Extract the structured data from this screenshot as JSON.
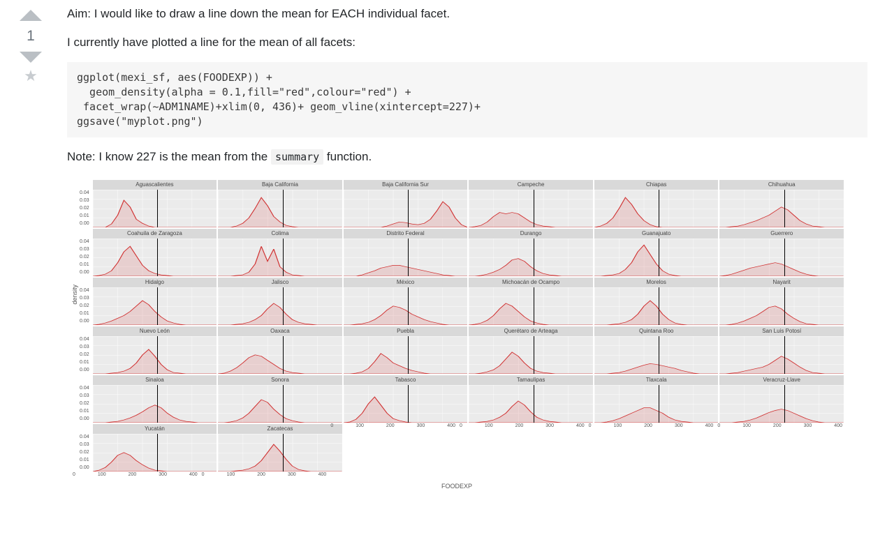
{
  "vote": {
    "count": "1"
  },
  "post": {
    "aim": "Aim: I would like to draw a line down the mean for EACH individual facet.",
    "intro": "I currently have plotted a line for the mean of all facets:",
    "code": "ggplot(mexi_sf, aes(FOODEXP)) +\n  geom_density(alpha = 0.1,fill=\"red\",colour=\"red\") +\n facet_wrap(~ADM1NAME)+xlim(0, 436)+ geom_vline(xintercept=227)+\nggsave(\"myplot.png\")",
    "note_prefix": "Note: I know 227 is the mean from the ",
    "note_code": "summary",
    "note_suffix": " function."
  },
  "chart_data": {
    "type": "facet-density",
    "xlabel": "FOODEXP",
    "ylabel": "density",
    "xlim": [
      0,
      436
    ],
    "xticks": [
      "0",
      "100",
      "200",
      "300",
      "400"
    ],
    "yticks": [
      "0.04",
      "0.03",
      "0.02",
      "0.01",
      "0.00"
    ],
    "vline_x": 227,
    "fill": "#ff9d9d",
    "stroke": "#d02f2f",
    "alpha": 0.15,
    "cols": 6,
    "facets": [
      {
        "name": "Aguascalientes",
        "curve": [
          0,
          0,
          0,
          5,
          18,
          40,
          30,
          12,
          6,
          2,
          0,
          0,
          0,
          0,
          0,
          0,
          0,
          0,
          0,
          0,
          0
        ]
      },
      {
        "name": "Baja California",
        "curve": [
          0,
          0,
          0,
          2,
          6,
          14,
          28,
          44,
          32,
          16,
          8,
          3,
          1,
          0,
          0,
          0,
          0,
          0,
          0,
          0,
          0
        ]
      },
      {
        "name": "Baja California Sur",
        "curve": [
          0,
          0,
          0,
          0,
          0,
          0,
          0,
          2,
          5,
          8,
          7,
          5,
          4,
          6,
          12,
          24,
          38,
          30,
          14,
          4,
          0
        ]
      },
      {
        "name": "Campeche",
        "curve": [
          0,
          1,
          3,
          8,
          16,
          22,
          20,
          22,
          20,
          14,
          8,
          4,
          2,
          1,
          0,
          0,
          0,
          0,
          0,
          0,
          0
        ]
      },
      {
        "name": "Chiapas",
        "curve": [
          0,
          2,
          6,
          14,
          28,
          44,
          34,
          20,
          10,
          4,
          1,
          0,
          0,
          0,
          0,
          0,
          0,
          0,
          0,
          0,
          0
        ]
      },
      {
        "name": "Chihuahua",
        "curve": [
          0,
          0,
          1,
          2,
          4,
          7,
          10,
          14,
          18,
          24,
          30,
          26,
          18,
          10,
          5,
          2,
          1,
          0,
          0,
          0,
          0
        ]
      },
      {
        "name": "Coahuila de Zaragoza",
        "curve": [
          0,
          1,
          3,
          8,
          20,
          36,
          44,
          30,
          16,
          8,
          4,
          2,
          1,
          0,
          0,
          0,
          0,
          0,
          0,
          0,
          0
        ]
      },
      {
        "name": "Colima",
        "curve": [
          0,
          0,
          0,
          1,
          2,
          6,
          18,
          44,
          22,
          40,
          14,
          6,
          2,
          1,
          0,
          0,
          0,
          0,
          0,
          0,
          0
        ]
      },
      {
        "name": "Distrito Federal",
        "curve": [
          0,
          0,
          0,
          2,
          5,
          8,
          12,
          14,
          16,
          16,
          14,
          12,
          10,
          8,
          6,
          4,
          2,
          1,
          0,
          0,
          0
        ]
      },
      {
        "name": "Durango",
        "curve": [
          0,
          0,
          1,
          3,
          6,
          10,
          16,
          24,
          26,
          22,
          14,
          8,
          4,
          2,
          1,
          0,
          0,
          0,
          0,
          0,
          0
        ]
      },
      {
        "name": "Guanajuato",
        "curve": [
          0,
          0,
          1,
          2,
          4,
          10,
          20,
          36,
          46,
          32,
          18,
          8,
          3,
          1,
          0,
          0,
          0,
          0,
          0,
          0,
          0
        ]
      },
      {
        "name": "Guerrero",
        "curve": [
          0,
          1,
          3,
          6,
          9,
          12,
          14,
          16,
          18,
          20,
          18,
          14,
          10,
          6,
          3,
          1,
          0,
          0,
          0,
          0,
          0
        ]
      },
      {
        "name": "Hidalgo",
        "curve": [
          0,
          1,
          3,
          6,
          10,
          14,
          20,
          28,
          36,
          30,
          20,
          12,
          6,
          3,
          1,
          0,
          0,
          0,
          0,
          0,
          0
        ]
      },
      {
        "name": "Jalisco",
        "curve": [
          0,
          0,
          0,
          1,
          2,
          4,
          8,
          14,
          24,
          32,
          26,
          16,
          8,
          4,
          2,
          1,
          0,
          0,
          0,
          0,
          0
        ]
      },
      {
        "name": "México",
        "curve": [
          0,
          0,
          1,
          2,
          4,
          8,
          14,
          22,
          28,
          26,
          22,
          16,
          12,
          8,
          5,
          3,
          1,
          0,
          0,
          0,
          0
        ]
      },
      {
        "name": "Michoacán de Ocampo",
        "curve": [
          0,
          1,
          3,
          7,
          14,
          24,
          32,
          28,
          20,
          12,
          6,
          3,
          1,
          0,
          0,
          0,
          0,
          0,
          0,
          0,
          0
        ]
      },
      {
        "name": "Morelos",
        "curve": [
          0,
          0,
          0,
          1,
          2,
          4,
          8,
          16,
          28,
          36,
          28,
          16,
          8,
          3,
          1,
          0,
          0,
          0,
          0,
          0,
          0
        ]
      },
      {
        "name": "Nayarit",
        "curve": [
          0,
          0,
          1,
          3,
          6,
          10,
          14,
          20,
          26,
          28,
          24,
          16,
          10,
          5,
          2,
          1,
          0,
          0,
          0,
          0,
          0
        ]
      },
      {
        "name": "Nuevo León",
        "curve": [
          0,
          0,
          0,
          1,
          2,
          4,
          8,
          16,
          28,
          36,
          26,
          14,
          6,
          2,
          1,
          0,
          0,
          0,
          0,
          0,
          0
        ]
      },
      {
        "name": "Oaxaca",
        "curve": [
          0,
          1,
          4,
          9,
          16,
          24,
          28,
          26,
          20,
          14,
          8,
          4,
          2,
          1,
          0,
          0,
          0,
          0,
          0,
          0,
          0
        ]
      },
      {
        "name": "Puebla",
        "curve": [
          0,
          0,
          1,
          3,
          8,
          18,
          30,
          24,
          16,
          12,
          8,
          5,
          3,
          1,
          0,
          0,
          0,
          0,
          0,
          0,
          0
        ]
      },
      {
        "name": "Querétaro de Arteaga",
        "curve": [
          0,
          0,
          1,
          3,
          6,
          12,
          22,
          32,
          26,
          16,
          8,
          4,
          2,
          1,
          0,
          0,
          0,
          0,
          0,
          0,
          0
        ]
      },
      {
        "name": "Quintana Roo",
        "curve": [
          0,
          0,
          0,
          1,
          2,
          4,
          7,
          10,
          13,
          15,
          14,
          12,
          10,
          8,
          5,
          3,
          1,
          0,
          0,
          0,
          0
        ]
      },
      {
        "name": "San Luis Potosí",
        "curve": [
          0,
          0,
          1,
          2,
          4,
          6,
          8,
          10,
          14,
          20,
          26,
          22,
          16,
          10,
          5,
          2,
          1,
          0,
          0,
          0,
          0
        ]
      },
      {
        "name": "Sinaloa",
        "curve": [
          0,
          0,
          0,
          1,
          2,
          4,
          7,
          11,
          16,
          22,
          26,
          22,
          14,
          8,
          4,
          2,
          1,
          0,
          0,
          0,
          0
        ]
      },
      {
        "name": "Sonora",
        "curve": [
          0,
          0,
          1,
          3,
          7,
          14,
          24,
          34,
          30,
          20,
          12,
          6,
          3,
          1,
          0,
          0,
          0,
          0,
          0,
          0,
          0
        ]
      },
      {
        "name": "Tabasco",
        "curve": [
          0,
          1,
          5,
          14,
          28,
          38,
          26,
          14,
          6,
          3,
          1,
          0,
          0,
          0,
          0,
          0,
          0,
          0,
          0,
          0,
          0
        ]
      },
      {
        "name": "Tamaulipas",
        "curve": [
          0,
          0,
          1,
          2,
          4,
          8,
          14,
          24,
          32,
          26,
          16,
          8,
          4,
          2,
          1,
          0,
          0,
          0,
          0,
          0,
          0
        ]
      },
      {
        "name": "Tlaxcala",
        "curve": [
          0,
          0,
          1,
          3,
          6,
          10,
          14,
          18,
          22,
          22,
          18,
          14,
          8,
          4,
          2,
          1,
          0,
          0,
          0,
          0,
          0
        ]
      },
      {
        "name": "Veracruz-Llave",
        "curve": [
          0,
          0,
          0,
          1,
          2,
          4,
          7,
          11,
          15,
          18,
          20,
          18,
          14,
          10,
          6,
          3,
          1,
          0,
          0,
          0,
          0
        ]
      },
      {
        "name": "Yucatán",
        "curve": [
          0,
          2,
          6,
          14,
          24,
          28,
          24,
          16,
          10,
          5,
          2,
          1,
          0,
          0,
          0,
          0,
          0,
          0,
          0,
          0,
          0
        ]
      },
      {
        "name": "Zacatecas",
        "curve": [
          0,
          0,
          0,
          1,
          2,
          4,
          8,
          16,
          28,
          40,
          30,
          18,
          8,
          3,
          1,
          0,
          0,
          0,
          0,
          0,
          0
        ]
      }
    ]
  }
}
